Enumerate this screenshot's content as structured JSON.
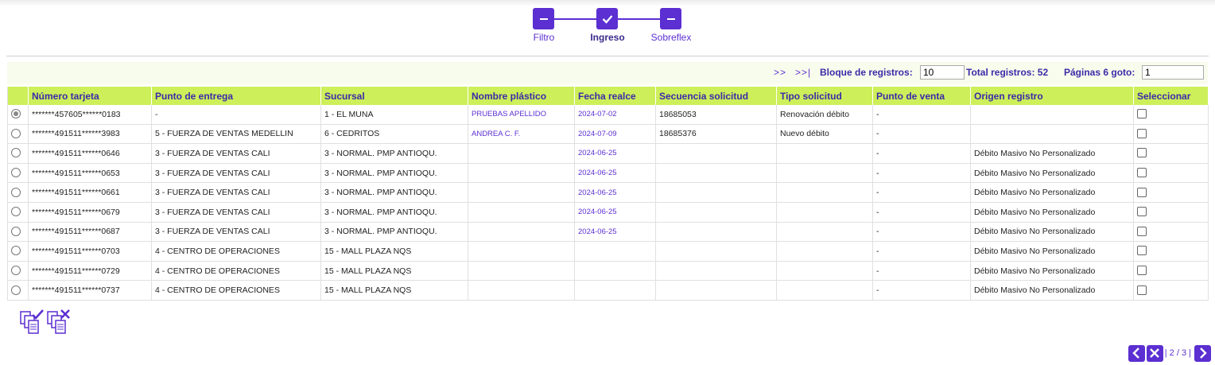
{
  "stepper": {
    "steps": [
      {
        "label": "Filtro",
        "icon": "minus-icon"
      },
      {
        "label": "Ingreso",
        "icon": "check-icon"
      },
      {
        "label": "Sobreflex",
        "icon": "minus-icon"
      }
    ]
  },
  "toolbar": {
    "nav_next": ">>",
    "nav_last": ">>|",
    "block_label": "Bloque de registros:",
    "block_value": "10",
    "total_label": "Total registros: 52",
    "pages_label": "Páginas 6 goto:",
    "goto_value": "1"
  },
  "table": {
    "headers": [
      "",
      "Número tarjeta",
      "Punto de entrega",
      "Sucursal",
      "Nombre plástico",
      "Fecha realce",
      "Secuencia solicitud",
      "Tipo solicitud",
      "Punto de venta",
      "Origen registro",
      "Seleccionar"
    ],
    "rows": [
      {
        "selected": true,
        "tarjeta": "*******457605******0183",
        "entrega": "-",
        "sucursal": "1 - EL MUNA",
        "nombre": "PRUEBAS APELLIDO",
        "fecha": "2024-07-02",
        "secuencia": "18685053",
        "tipo": "Renovación débito",
        "venta": "-",
        "origen": ""
      },
      {
        "selected": false,
        "tarjeta": "*******491511******3983",
        "entrega": "5 - FUERZA DE VENTAS MEDELLIN",
        "sucursal": "6 - CEDRITOS",
        "nombre": "ANDREA C. F.",
        "fecha": "2024-07-09",
        "secuencia": "18685376",
        "tipo": "Nuevo débito",
        "venta": "-",
        "origen": ""
      },
      {
        "selected": false,
        "tarjeta": "*******491511******0646",
        "entrega": "3 - FUERZA DE VENTAS CALI",
        "sucursal": "3 - NORMAL. PMP ANTIOQU.",
        "nombre": "",
        "fecha": "2024-06-25",
        "secuencia": "",
        "tipo": "",
        "venta": "-",
        "origen": "Débito Masivo No Personalizado"
      },
      {
        "selected": false,
        "tarjeta": "*******491511******0653",
        "entrega": "3 - FUERZA DE VENTAS CALI",
        "sucursal": "3 - NORMAL. PMP ANTIOQU.",
        "nombre": "",
        "fecha": "2024-06-25",
        "secuencia": "",
        "tipo": "",
        "venta": "-",
        "origen": "Débito Masivo No Personalizado"
      },
      {
        "selected": false,
        "tarjeta": "*******491511******0661",
        "entrega": "3 - FUERZA DE VENTAS CALI",
        "sucursal": "3 - NORMAL. PMP ANTIOQU.",
        "nombre": "",
        "fecha": "2024-06-25",
        "secuencia": "",
        "tipo": "",
        "venta": "-",
        "origen": "Débito Masivo No Personalizado"
      },
      {
        "selected": false,
        "tarjeta": "*******491511******0679",
        "entrega": "3 - FUERZA DE VENTAS CALI",
        "sucursal": "3 - NORMAL. PMP ANTIOQU.",
        "nombre": "",
        "fecha": "2024-06-25",
        "secuencia": "",
        "tipo": "",
        "venta": "-",
        "origen": "Débito Masivo No Personalizado"
      },
      {
        "selected": false,
        "tarjeta": "*******491511******0687",
        "entrega": "3 - FUERZA DE VENTAS CALI",
        "sucursal": "3 - NORMAL. PMP ANTIOQU.",
        "nombre": "",
        "fecha": "2024-06-25",
        "secuencia": "",
        "tipo": "",
        "venta": "-",
        "origen": "Débito Masivo No Personalizado"
      },
      {
        "selected": false,
        "tarjeta": "*******491511******0703",
        "entrega": "4 - CENTRO DE OPERACIONES",
        "sucursal": "15 - MALL PLAZA NQS",
        "nombre": "",
        "fecha": "",
        "secuencia": "",
        "tipo": "",
        "venta": "-",
        "origen": "Débito Masivo No Personalizado"
      },
      {
        "selected": false,
        "tarjeta": "*******491511******0729",
        "entrega": "4 - CENTRO DE OPERACIONES",
        "sucursal": "15 - MALL PLAZA NQS",
        "nombre": "",
        "fecha": "",
        "secuencia": "",
        "tipo": "",
        "venta": "-",
        "origen": "Débito Masivo No Personalizado"
      },
      {
        "selected": false,
        "tarjeta": "*******491511******0737",
        "entrega": "4 - CENTRO DE OPERACIONES",
        "sucursal": "15 - MALL PLAZA NQS",
        "nombre": "",
        "fecha": "",
        "secuencia": "",
        "tipo": "",
        "venta": "-",
        "origen": "Débito Masivo No Personalizado"
      }
    ]
  },
  "actions": {
    "icons": [
      "approve-documents-icon",
      "reject-documents-icon"
    ]
  },
  "pager": {
    "text": "| 2 / 3 |",
    "icons": [
      "chevron-left-icon",
      "close-icon",
      "chevron-right-icon"
    ]
  },
  "colors": {
    "accent": "#5b2fd1",
    "header_bg": "#cdef5a",
    "toolbar_bg": "#f8fcec",
    "header_text": "#3b2aa8"
  }
}
